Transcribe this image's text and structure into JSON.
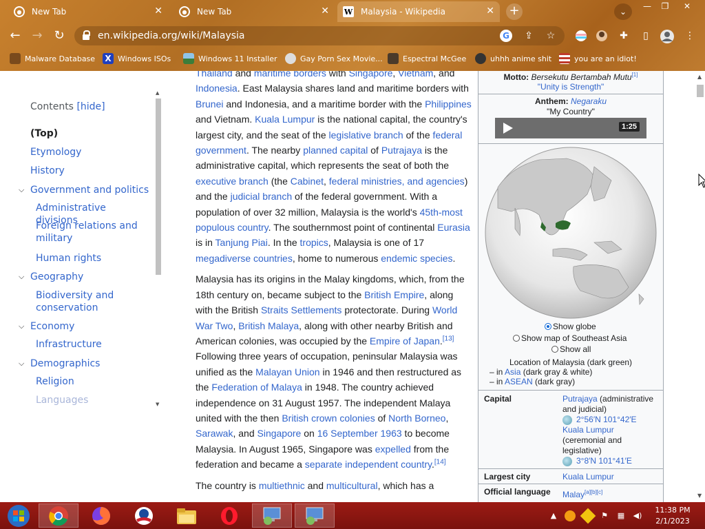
{
  "browser": {
    "tabs": [
      {
        "title": "New Tab",
        "active": false
      },
      {
        "title": "New Tab",
        "active": false
      },
      {
        "title": "Malaysia - Wikipedia",
        "active": true
      }
    ],
    "new_tab_glyph": "+",
    "close_glyph": "✕",
    "url": "en.wikipedia.org/wiki/Malaysia",
    "bookmarks": [
      {
        "label": "Malware Database",
        "icon": "leaf-icon",
        "color": "#7a4a1c"
      },
      {
        "label": "Windows ISOs",
        "icon": "x-icon",
        "color": "#1f3fbf"
      },
      {
        "label": "Windows 11 Installer",
        "icon": "picture-icon",
        "color": "#3c7d3a"
      },
      {
        "label": "Gay Porn Sex Movie...",
        "icon": "skull-icon",
        "color": "#dddddd"
      },
      {
        "label": "Espectral McGee",
        "icon": "avatar-icon",
        "color": "#4a3a2a"
      },
      {
        "label": "uhhh anime shit",
        "icon": "anime-icon",
        "color": "#333333"
      },
      {
        "label": "you are an idiot!",
        "icon": "flag-icon",
        "color": "#c0392b"
      }
    ]
  },
  "toc": {
    "title": "Contents",
    "hide_label": "[hide]",
    "items": [
      {
        "label": "(Top)",
        "level": 0,
        "expandable": false
      },
      {
        "label": "Etymology",
        "level": 0,
        "expandable": false
      },
      {
        "label": "History",
        "level": 0,
        "expandable": false
      },
      {
        "label": "Government and politics",
        "level": 0,
        "expandable": true
      },
      {
        "label": "Administrative divisions",
        "level": 1,
        "expandable": false
      },
      {
        "label": "Foreign relations and military",
        "level": 1,
        "expandable": false
      },
      {
        "label": "Human rights",
        "level": 1,
        "expandable": false
      },
      {
        "label": "Geography",
        "level": 0,
        "expandable": true
      },
      {
        "label": "Biodiversity and conservation",
        "level": 1,
        "expandable": false
      },
      {
        "label": "Economy",
        "level": 0,
        "expandable": true
      },
      {
        "label": "Infrastructure",
        "level": 1,
        "expandable": false
      },
      {
        "label": "Demographics",
        "level": 0,
        "expandable": true
      },
      {
        "label": "Religion",
        "level": 1,
        "expandable": false
      },
      {
        "label": "Languages",
        "level": 1,
        "expandable": false
      }
    ]
  },
  "article": {
    "paragraphs": [
      [
        {
          "t": "Thailand",
          "l": true
        },
        {
          "t": " and "
        },
        {
          "t": "maritime borders",
          "l": true
        },
        {
          "t": " with "
        },
        {
          "t": "Singapore",
          "l": true
        },
        {
          "t": ", "
        },
        {
          "t": "Vietnam",
          "l": true
        },
        {
          "t": ", and "
        },
        {
          "t": "Indonesia",
          "l": true
        },
        {
          "t": ". East Malaysia shares land and maritime borders with "
        },
        {
          "t": "Brunei",
          "l": true
        },
        {
          "t": " and Indonesia, and a maritime border with the "
        },
        {
          "t": "Philippines",
          "l": true
        },
        {
          "t": " and Vietnam. "
        },
        {
          "t": "Kuala Lumpur",
          "l": true
        },
        {
          "t": " is the national capital, the country's largest city, and the seat of the "
        },
        {
          "t": "legislative branch",
          "l": true
        },
        {
          "t": " of the "
        },
        {
          "t": "federal government",
          "l": true
        },
        {
          "t": ". The nearby "
        },
        {
          "t": "planned capital",
          "l": true
        },
        {
          "t": " of "
        },
        {
          "t": "Putrajaya",
          "l": true
        },
        {
          "t": " is the administrative capital, which represents the seat of both the "
        },
        {
          "t": "executive branch",
          "l": true
        },
        {
          "t": " (the "
        },
        {
          "t": "Cabinet",
          "l": true
        },
        {
          "t": ", "
        },
        {
          "t": "federal ministries, and agencies",
          "l": true
        },
        {
          "t": ") and the "
        },
        {
          "t": "judicial branch",
          "l": true
        },
        {
          "t": " of the federal government. With a population of over 32 million, Malaysia is the world's "
        },
        {
          "t": "45th-most populous country",
          "l": true
        },
        {
          "t": ". The southernmost point of continental "
        },
        {
          "t": "Eurasia",
          "l": true
        },
        {
          "t": " is in "
        },
        {
          "t": "Tanjung Piai",
          "l": true
        },
        {
          "t": ". In the "
        },
        {
          "t": "tropics",
          "l": true
        },
        {
          "t": ", Malaysia is one of 17 "
        },
        {
          "t": "megadiverse countries",
          "l": true
        },
        {
          "t": ", home to numerous "
        },
        {
          "t": "endemic species",
          "l": true
        },
        {
          "t": "."
        }
      ],
      [
        {
          "t": "Malaysia has its origins in the Malay kingdoms, which, from the 18th century on, became subject to the "
        },
        {
          "t": "British Empire",
          "l": true
        },
        {
          "t": ", along with the British "
        },
        {
          "t": "Straits Settlements",
          "l": true
        },
        {
          "t": " protectorate. During "
        },
        {
          "t": "World War Two",
          "l": true
        },
        {
          "t": ", "
        },
        {
          "t": "British Malaya",
          "l": true
        },
        {
          "t": ", along with other nearby British and American colonies, was occupied by the "
        },
        {
          "t": "Empire of Japan",
          "l": true
        },
        {
          "t": ".",
          "s": "[13]"
        },
        {
          "t": " Following three years of occupation, peninsular Malaysia was unified as the "
        },
        {
          "t": "Malayan Union",
          "l": true
        },
        {
          "t": " in 1946 and then restructured as the "
        },
        {
          "t": "Federation of Malaya",
          "l": true
        },
        {
          "t": " in 1948. The country achieved independence on 31 August 1957. The independent Malaya united with the then "
        },
        {
          "t": "British crown colonies",
          "l": true
        },
        {
          "t": " of "
        },
        {
          "t": "North Borneo",
          "l": true
        },
        {
          "t": ", "
        },
        {
          "t": "Sarawak",
          "l": true
        },
        {
          "t": ", and "
        },
        {
          "t": "Singapore",
          "l": true
        },
        {
          "t": " on "
        },
        {
          "t": "16 September 1963",
          "l": true
        },
        {
          "t": " to become Malaysia. In August 1965, Singapore was "
        },
        {
          "t": "expelled",
          "l": true
        },
        {
          "t": " from the federation and became a "
        },
        {
          "t": "separate independent country",
          "l": true
        },
        {
          "t": ".",
          "s": "[14]"
        }
      ],
      [
        {
          "t": "The country is "
        },
        {
          "t": "multiethnic",
          "l": true
        },
        {
          "t": " and "
        },
        {
          "t": "multicultural",
          "l": true
        },
        {
          "t": ", which has a"
        }
      ]
    ]
  },
  "infobox": {
    "motto_label": "Motto:",
    "motto": "Bersekutu Bertambah Mutu",
    "motto_ref": "[1]",
    "motto_translation": "\"Unity is Strength\"",
    "anthem_label": "Anthem:",
    "anthem": "Negaraku",
    "anthem_translation": "\"My Country\"",
    "audio_duration": "1:25",
    "map_options": [
      {
        "label": "Show globe",
        "selected": true
      },
      {
        "label": "Show map of Southeast Asia",
        "selected": false
      },
      {
        "label": "Show all",
        "selected": false
      }
    ],
    "map_caption": "Location of Malaysia (dark green)",
    "map_legend": [
      {
        "prefix": "– in ",
        "link": "Asia",
        "suffix": " (dark gray & white)"
      },
      {
        "prefix": "– in ",
        "link": "ASEAN",
        "suffix": " (dark gray)"
      }
    ],
    "capital_label": "Capital",
    "capital1": "Putrajaya",
    "capital1_note": " (administrative and judicial)",
    "capital1_coord": "2°56′N 101°42′E",
    "capital2": "Kuala Lumpur",
    "capital2_note": "(ceremonial and legislative)",
    "capital2_coord": "3°8′N 101°41′E",
    "largest_city_label": "Largest city",
    "largest_city": "Kuala Lumpur",
    "official_language_label": "Official language",
    "official_language": "Malay",
    "official_language_refs": "[a][b][c]"
  },
  "taskbar": {
    "apps": [
      {
        "name": "start-button"
      },
      {
        "name": "chrome-app",
        "active": true
      },
      {
        "name": "firefox-app"
      },
      {
        "name": "obama-app"
      },
      {
        "name": "file-explorer-app"
      },
      {
        "name": "opera-app"
      },
      {
        "name": "remote-app-1"
      },
      {
        "name": "remote-app-2"
      }
    ],
    "time": "11:38 PM",
    "date": "2/1/2023"
  }
}
